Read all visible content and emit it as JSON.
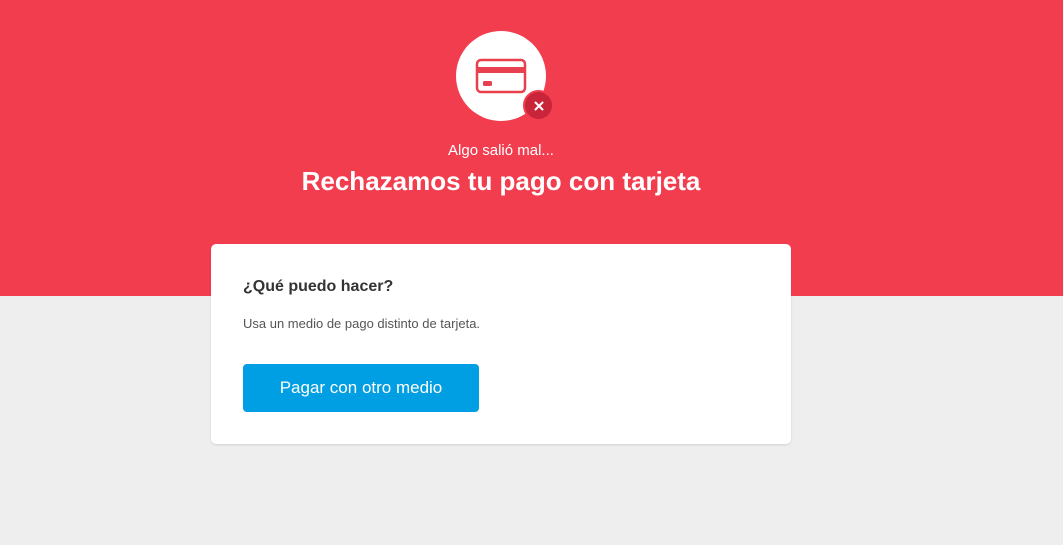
{
  "colors": {
    "banner_background": "#f23d4f",
    "badge_background": "#c8243a",
    "icon_color": "#e8404f",
    "button_background": "#009ee3",
    "page_background": "#eeeeee"
  },
  "icons": {
    "status": "credit-card-icon",
    "badge": "close-icon"
  },
  "header": {
    "subtitle": "Algo salió mal...",
    "title": "Rechazamos tu pago con tarjeta"
  },
  "card": {
    "heading": "¿Qué puedo hacer?",
    "text": "Usa un medio de pago distinto de tarjeta.",
    "button_label": "Pagar con otro medio"
  }
}
